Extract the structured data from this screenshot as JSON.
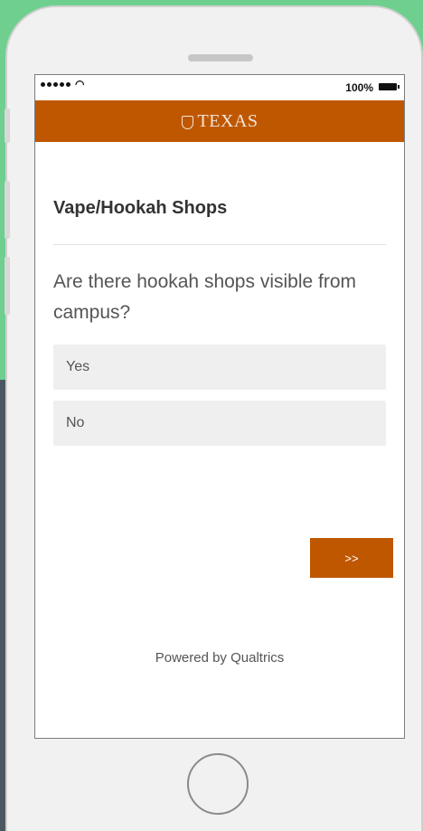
{
  "status_bar": {
    "battery_text": "100%"
  },
  "header": {
    "brand": "TEXAS",
    "accent_color": "#bf5700",
    "icon": "shield-icon"
  },
  "survey": {
    "title": "Vape/Hookah Shops",
    "question": "Are there hookah shops visible from campus?",
    "choices": [
      "Yes",
      "No"
    ],
    "next_label": ">>"
  },
  "footer": {
    "powered_by": "Powered by Qualtrics"
  }
}
